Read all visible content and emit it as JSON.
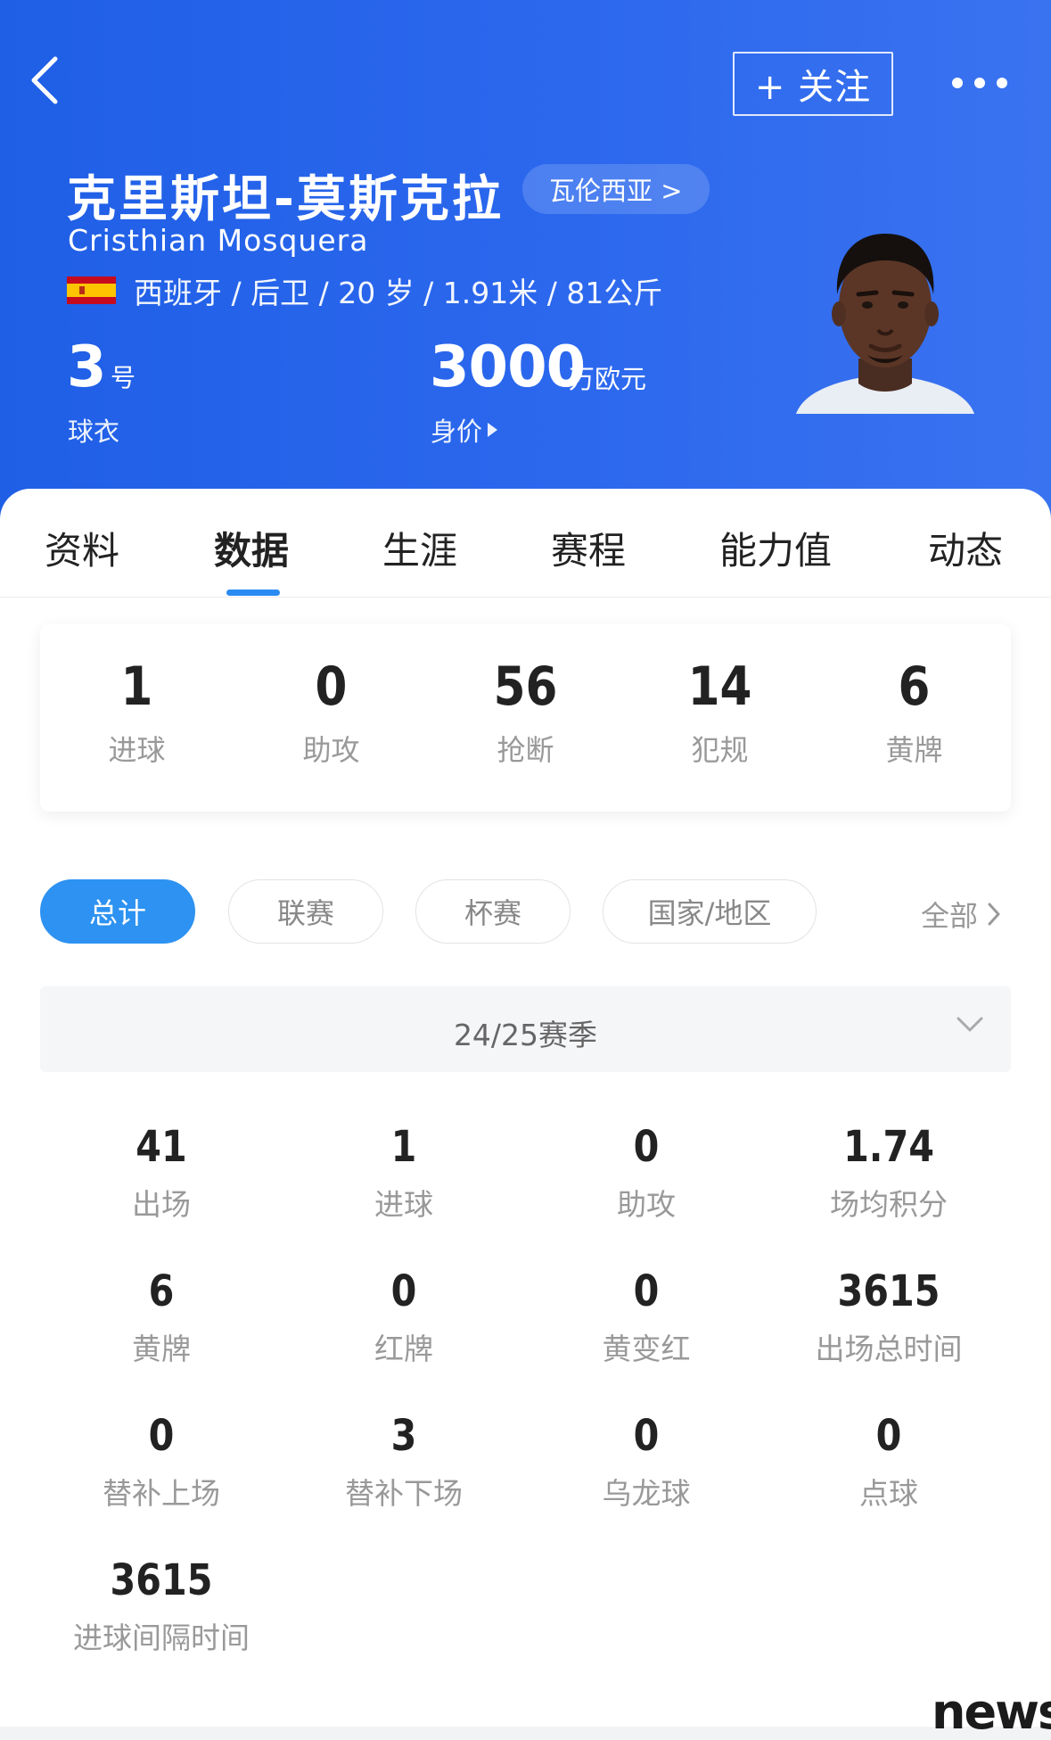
{
  "header": {
    "follow_label": "+ 关注",
    "player_name_cn": "克里斯坦-莫斯克拉",
    "club_link": "瓦伦西亚 >",
    "player_name_en": "Cristhian Mosquera",
    "bio": "西班牙 / 后卫 / 20 岁 / 1.91米 / 81公斤",
    "flag": "spain-flag",
    "shirt_number": "3",
    "shirt_unit": "号",
    "shirt_label": "球衣",
    "market_value": "3000",
    "market_value_unit": "万欧元",
    "market_value_label": "身价",
    "colors": {
      "header_blue": "#2563eb",
      "accent_blue": "#2d92f1"
    }
  },
  "tabs": [
    "资料",
    "数据",
    "生涯",
    "赛程",
    "能力值",
    "动态"
  ],
  "active_tab": "数据",
  "summary": [
    {
      "value": "1",
      "label": "进球"
    },
    {
      "value": "0",
      "label": "助攻"
    },
    {
      "value": "56",
      "label": "抢断"
    },
    {
      "value": "14",
      "label": "犯规"
    },
    {
      "value": "6",
      "label": "黄牌"
    }
  ],
  "filters": {
    "chips": [
      "总计",
      "联赛",
      "杯赛",
      "国家/地区"
    ],
    "active": "总计",
    "all_label": "全部"
  },
  "season": {
    "selected": "24/25赛季"
  },
  "stats": [
    {
      "value": "41",
      "label": "出场"
    },
    {
      "value": "1",
      "label": "进球"
    },
    {
      "value": "0",
      "label": "助攻"
    },
    {
      "value": "1.74",
      "label": "场均积分"
    },
    {
      "value": "6",
      "label": "黄牌"
    },
    {
      "value": "0",
      "label": "红牌"
    },
    {
      "value": "0",
      "label": "黄变红"
    },
    {
      "value": "3615",
      "label": "出场总时间"
    },
    {
      "value": "0",
      "label": "替补上场"
    },
    {
      "value": "3",
      "label": "替补下场"
    },
    {
      "value": "0",
      "label": "乌龙球"
    },
    {
      "value": "0",
      "label": "点球"
    },
    {
      "value": "3615",
      "label": "进球间隔时间"
    }
  ],
  "watermark": "news"
}
